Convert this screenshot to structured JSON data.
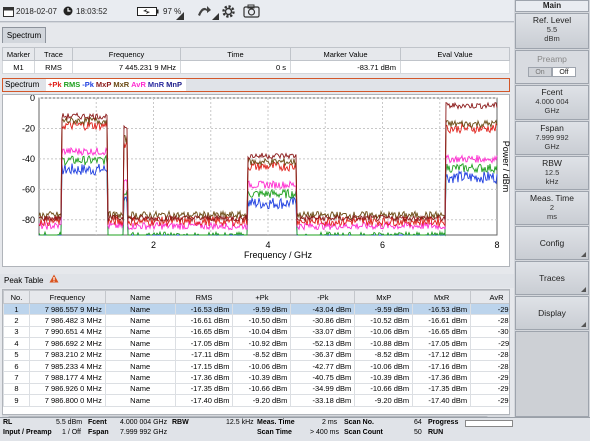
{
  "status": {
    "date": "2018-02-07",
    "time": "18:03:52",
    "battery": "97 %"
  },
  "spectrum_tab": "Spectrum",
  "marker_table": {
    "headers": [
      "Marker",
      "Trace",
      "Frequency",
      "Time",
      "Marker Value",
      "Eval Value"
    ],
    "row": {
      "marker": "M1",
      "trace": "RMS",
      "frequency": "7 445.231 9 MHz",
      "time": "0 s",
      "marker_value": "-83.71 dBm",
      "eval_value": ""
    }
  },
  "trace_bar": {
    "label": "Spectrum",
    "traces": [
      {
        "label": "+Pk",
        "color": "#e0201a"
      },
      {
        "label": "RMS",
        "color": "#1fa01f"
      },
      {
        "label": "-Pk",
        "color": "#1f3fe0"
      },
      {
        "label": "MxP",
        "color": "#8b1a1a"
      },
      {
        "label": "MxR",
        "color": "#6b4a14"
      },
      {
        "label": "AvR",
        "color": "#ff2bd0"
      },
      {
        "label": "MnR",
        "color": "#2a2aa0"
      },
      {
        "label": "MnP",
        "color": "#1a1a8a"
      }
    ]
  },
  "chart_data": {
    "type": "line",
    "xlabel": "Frequency / GHz",
    "ylabel": "Power / dBm",
    "xlim": [
      0,
      8
    ],
    "ylim": [
      -90,
      0
    ],
    "x_ticks": [
      "2",
      "4",
      "6",
      "8"
    ],
    "y_ticks": [
      "0",
      "-20",
      "-40",
      "-60",
      "-80"
    ],
    "grid": true,
    "bands": [
      {
        "name": "band-1",
        "x": [
          0.4,
          1.2
        ],
        "maxp": -12,
        "pk": -18,
        "avr": -35
      },
      {
        "name": "band-2",
        "x": [
          1.48,
          1.55
        ],
        "maxp": -18,
        "pk": -30,
        "avr": -55
      },
      {
        "name": "band-3",
        "x": [
          3.65,
          4.5
        ],
        "maxp": -38,
        "pk": -45,
        "avr": -57
      },
      {
        "name": "band-4",
        "x": [
          7.1,
          8.0
        ],
        "maxp": -5,
        "pk": -20,
        "avr": -40
      }
    ],
    "noise_floor": -84
  },
  "peak_table": {
    "title": "Peak Table",
    "headers": [
      "No.",
      "Frequency",
      "Name",
      "RMS",
      "+Pk",
      "-Pk",
      "MxP",
      "MxR",
      "AvR"
    ],
    "rows": [
      [
        "1",
        "7 986.557 9 MHz",
        "Name",
        "-16.53 dBm",
        "-9.59 dBm",
        "-43.04 dBm",
        "-9.59 dBm",
        "-16.53 dBm",
        "-29.24"
      ],
      [
        "2",
        "7 986.482 3 MHz",
        "Name",
        "-16.61 dBm",
        "-10.50 dBm",
        "-30.86 dBm",
        "-10.52 dBm",
        "-16.61 dBm",
        "-28.94"
      ],
      [
        "3",
        "7 990.651 4 MHz",
        "Name",
        "-16.65 dBm",
        "-10.04 dBm",
        "-33.07 dBm",
        "-10.06 dBm",
        "-16.65 dBm",
        "-30.21"
      ],
      [
        "4",
        "7 986.692 2 MHz",
        "Name",
        "-17.05 dBm",
        "-10.92 dBm",
        "-52.13 dBm",
        "-10.88 dBm",
        "-17.05 dBm",
        "-29.11"
      ],
      [
        "5",
        "7 983.210 2 MHz",
        "Name",
        "-17.11 dBm",
        "-8.52 dBm",
        "-36.37 dBm",
        "-8.52 dBm",
        "-17.12 dBm",
        "-28.86"
      ],
      [
        "6",
        "7 985.233 4 MHz",
        "Name",
        "-17.15 dBm",
        "-10.06 dBm",
        "-42.77 dBm",
        "-10.06 dBm",
        "-17.16 dBm",
        "-28.74"
      ],
      [
        "7",
        "7 988.177 4 MHz",
        "Name",
        "-17.36 dBm",
        "-10.39 dBm",
        "-40.75 dBm",
        "-10.39 dBm",
        "-17.36 dBm",
        "-29.95"
      ],
      [
        "8",
        "7 986.926 0 MHz",
        "Name",
        "-17.35 dBm",
        "-10.66 dBm",
        "-34.99 dBm",
        "-10.66 dBm",
        "-17.35 dBm",
        "-29.90"
      ],
      [
        "9",
        "7 986.800 0 MHz",
        "Name",
        "-17.40 dBm",
        "-9.20 dBm",
        "-33.18 dBm",
        "-9.20 dBm",
        "-17.40 dBm",
        "-29.29"
      ]
    ]
  },
  "bottom_status": {
    "rl_label": "RL",
    "rl_value": "5.5 dBm",
    "input_label": "Input / Preamp",
    "input_value": "1 / Off",
    "fcent_label": "Fcent",
    "fcent_value": "4.000 004 GHz",
    "fspan_label": "Fspan",
    "fspan_value": "7.999 992 GHz",
    "rbw_label": "RBW",
    "rbw_value": "12.5 kHz",
    "meas_time_label": "Meas. Time",
    "meas_time_value": "2 ms",
    "scan_time_label": "Scan Time",
    "scan_time_value": "> 400 ms",
    "scan_no_label": "Scan No.",
    "scan_no_value": "64",
    "scan_count_label": "Scan Count",
    "scan_count_value": "50",
    "progress_label": "Progress",
    "run_label": "RUN"
  },
  "softkeys": {
    "main": "Main",
    "ref_level": {
      "label": "Ref. Level",
      "value": "5.5",
      "unit": "dBm"
    },
    "preamp": {
      "label": "Preamp",
      "on": "On",
      "off": "Off"
    },
    "fcent": {
      "label": "Fcent",
      "value": "4.000 004",
      "unit": "GHz"
    },
    "fspan": {
      "label": "Fspan",
      "value": "7.999 992",
      "unit": "GHz"
    },
    "rbw": {
      "label": "RBW",
      "value": "12.5",
      "unit": "kHz"
    },
    "meas_time": {
      "label": "Meas. Time",
      "value": "2",
      "unit": "ms"
    },
    "config": "Config",
    "traces": "Traces",
    "display": "Display"
  }
}
